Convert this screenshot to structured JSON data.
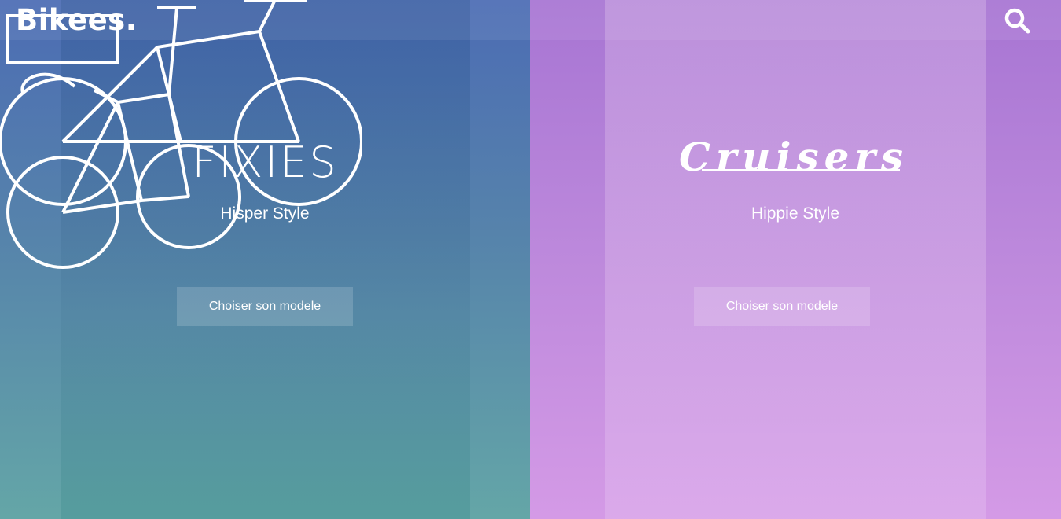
{
  "header": {
    "logo": "Bikees.",
    "search_icon": "search-icon"
  },
  "categories": [
    {
      "title": "FIXIES",
      "subtitle": "Hisper Style",
      "cta_label": "Choiser son modele",
      "theme_color": "#4c6cb4",
      "photo_subject": "bike-photo"
    },
    {
      "title": "Cruisers",
      "subtitle": "Hippie Style",
      "cta_label": "Choiser son modele",
      "theme_color": "#b57fd8",
      "photo_subject": "bike-photo"
    }
  ]
}
